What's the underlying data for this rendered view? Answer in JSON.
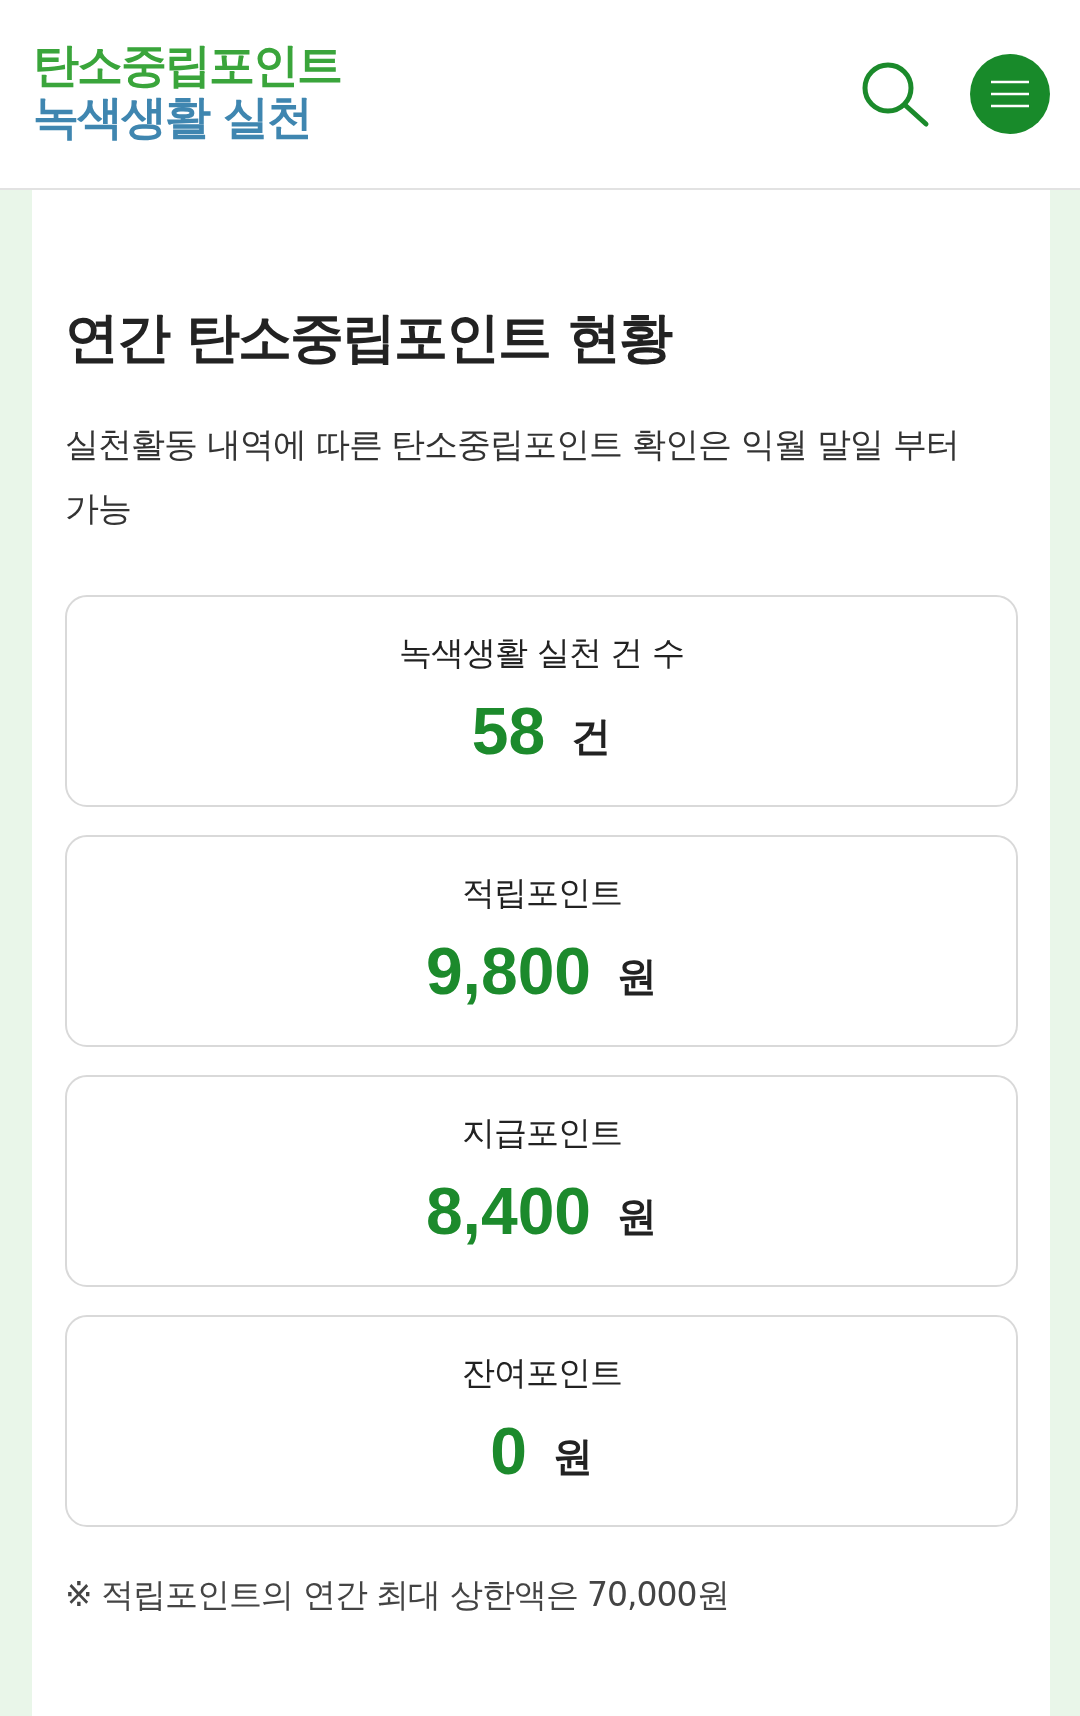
{
  "header": {
    "logo": {
      "line_1": "탄소중립포인트",
      "line_2": "녹색생활 실천"
    }
  },
  "page": {
    "title": "연간 탄소중립포인트 현황",
    "description": "실천활동 내역에 따른 탄소중립포인트 확인은 익월 말일 부터 가능"
  },
  "stats": [
    {
      "label": "녹색생활 실천 건 수",
      "value": "58",
      "unit": "건"
    },
    {
      "label": "적립포인트",
      "value": "9,800",
      "unit": "원"
    },
    {
      "label": "지급포인트",
      "value": "8,400",
      "unit": "원"
    },
    {
      "label": "잔여포인트",
      "value": "0",
      "unit": "원"
    }
  ],
  "note": "※ 적립포인트의 연간 최대 상한액은 70,000원"
}
